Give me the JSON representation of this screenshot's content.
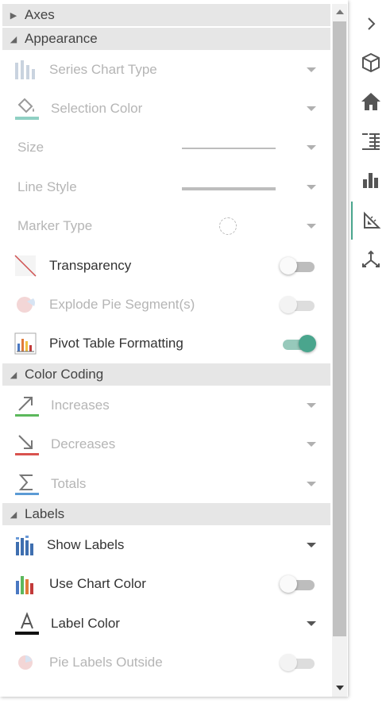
{
  "panel": {
    "sections": {
      "axes": "Axes",
      "appearance": "Appearance",
      "color_coding": "Color Coding",
      "labels": "Labels"
    },
    "appearance": {
      "series_chart_type": "Series Chart Type",
      "selection_color": "Selection Color",
      "size": "Size",
      "line_style": "Line Style",
      "marker_type": "Marker Type",
      "transparency": "Transparency",
      "explode_pie": "Explode Pie Segment(s)",
      "pivot_table_formatting": "Pivot Table Formatting"
    },
    "color_coding": {
      "increases": "Increases",
      "decreases": "Decreases",
      "totals": "Totals"
    },
    "labels": {
      "show_labels": "Show Labels",
      "use_chart_color": "Use Chart Color",
      "label_color": "Label Color",
      "pie_labels_outside": "Pie Labels Outside"
    },
    "toggles": {
      "transparency": false,
      "explode_pie": false,
      "pivot_table_formatting": true,
      "use_chart_color": false,
      "pie_labels_outside": false
    }
  },
  "colors": {
    "accent": "#4aa58d",
    "increase": "#5cb85c",
    "decrease": "#d9534f",
    "totals": "#5b9bd5"
  },
  "rail": {
    "icons": [
      "chevron-right-icon",
      "cube-icon",
      "home-icon",
      "table-icon",
      "bar-chart-icon",
      "chart-format-icon",
      "axes-3d-icon"
    ],
    "selected": "chart-format-icon"
  }
}
